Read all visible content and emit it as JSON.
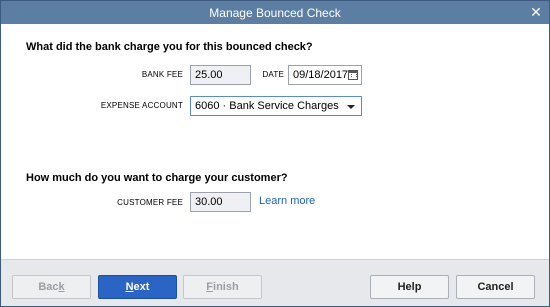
{
  "window": {
    "title": "Manage Bounced Check",
    "close_icon": "close-icon",
    "close_glyph": "✕"
  },
  "bank_section": {
    "question": "What did the bank charge you for this bounced check?",
    "bank_fee_label": "BANK FEE",
    "bank_fee_value": "25.00",
    "date_label": "DATE",
    "date_value": "09/18/2017",
    "calendar_icon": "calendar-icon",
    "expense_account_label": "EXPENSE ACCOUNT",
    "expense_account_value": "6060 · Bank Service Charges",
    "dropdown_icon": "chevron-down-icon"
  },
  "customer_section": {
    "question": "How much do you want to charge your customer?",
    "customer_fee_label": "CUSTOMER FEE",
    "customer_fee_value": "30.00",
    "learn_more": "Learn more"
  },
  "footer": {
    "back": {
      "pre": "Bac",
      "key": "k",
      "post": ""
    },
    "next": {
      "pre": "",
      "key": "N",
      "post": "ext"
    },
    "finish": {
      "pre": "",
      "key": "F",
      "post": "inish"
    },
    "help": "Help",
    "cancel": "Cancel"
  },
  "colors": {
    "titlebar": "#5d7ea3",
    "primary_button": "#2a64c4",
    "link": "#1f63b8",
    "footer_bg": "#e6e8eb"
  }
}
